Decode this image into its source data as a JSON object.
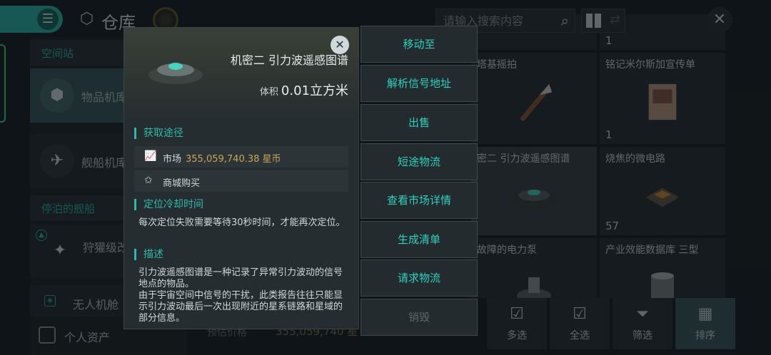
{
  "header": {
    "title": "仓库",
    "search_placeholder": "请输入搜索内容"
  },
  "sidebar": {
    "section_station": "空间站",
    "item_storage": "物品机库",
    "item_ship_hangar": "舰船机库",
    "section_docked": "停泊的舰船",
    "item_ship1": "狩獾级改",
    "item_drone": "无人机舱",
    "personal_assets": "个人资产"
  },
  "grid": {
    "cells": [
      {
        "name": "塔基摇拍",
        "qty": ""
      },
      {
        "name": "铭记米尔斯加宣传单",
        "qty": "1"
      },
      {
        "name": "密二 引力波遥感图谱",
        "qty": ""
      },
      {
        "name": "烧焦的微电路",
        "qty": "57"
      },
      {
        "name": "故障的电力泵",
        "qty": ""
      },
      {
        "name": "产业效能数据库 三型",
        "qty": ""
      }
    ],
    "top_qty": "1",
    "top_right_qty": "1"
  },
  "footer": {
    "estimate_label": "预估价格",
    "estimate_value": "355,059,740 星"
  },
  "bottom_buttons": {
    "multi": "多选",
    "all": "全选",
    "filter": "筛选",
    "sort": "排序"
  },
  "popup": {
    "item_name": "机密二 引力波遥感图谱",
    "volume_label": "体积",
    "volume_value": "0.01立方米",
    "sec_source": "获取途径",
    "market_label": "市场",
    "market_price": "355,059,740.38 星币",
    "shop_label": "商城购买",
    "sec_cooldown": "定位冷却时间",
    "cooldown_text": "每次定位失败需要等待30秒时间，才能再次定位。",
    "sec_desc": "描述",
    "desc_text": "引力波遥感图谱是一种记录了异常引力波动的信号地点的物品。\n由于宇宙空间中信号的干扰，此类报告往往只能显示引力波动最后一次出现附近的星系链路和星域的部分信息。"
  },
  "actions": [
    "移动至",
    "解析信号地址",
    "出售",
    "短途物流",
    "查看市场详情",
    "生成清单",
    "请求物流",
    "销毁"
  ]
}
